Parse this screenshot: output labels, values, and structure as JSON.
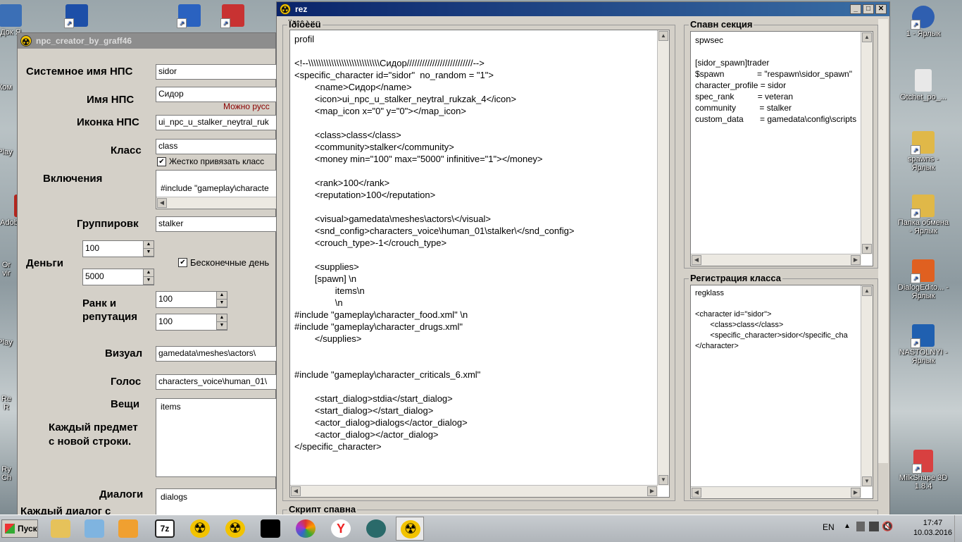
{
  "desktop": {
    "icons_left": [
      {
        "label": "Док\nЯ",
        "color": "#3b6fb6"
      },
      {
        "label": "Ком",
        "color": "#5a7fa8"
      },
      {
        "label": "Play",
        "color": "#2b5da0"
      },
      {
        "label": "Adob",
        "color": "#b3261e"
      },
      {
        "label": "Or\nvir",
        "color": "#3c7bc2"
      },
      {
        "label": "Play",
        "color": "#2b5da0"
      },
      {
        "label": "Re\nR",
        "color": "#c03030"
      },
      {
        "label": "Ry\nCh",
        "color": "#444"
      }
    ],
    "icons_top": [
      {
        "label": "",
        "color": "#1d4fa8"
      },
      {
        "label": "",
        "color": "#2a62c0"
      },
      {
        "label": "",
        "color": "#c83232"
      }
    ],
    "icons_right": [
      {
        "label": "1 - Ярлык",
        "color": "#2f5fb0"
      },
      {
        "label": "Otchet_po_...",
        "color": "#e8e8e8"
      },
      {
        "label": "spawns - Ярлык",
        "color": "#e0b848"
      },
      {
        "label": "Папка обмена - Ярлык",
        "color": "#e0b848"
      },
      {
        "label": "DialogEdito... - Ярлык",
        "color": "#e06020"
      },
      {
        "label": "NASTOLNYI - Ярлык",
        "color": "#2060b0"
      },
      {
        "label": "MilkShape 3D 1.8.4",
        "color": "#d84040"
      }
    ]
  },
  "npc_window": {
    "title": "npc_creator_by_graff46",
    "system_name_label": "Системное имя НПС",
    "system_name_value": "sidor",
    "name_label": "Имя  НПС",
    "name_value": "Сидор",
    "name_hint": "Можно русс",
    "icon_label": "Иконка НПС",
    "icon_value": "ui_npc_u_stalker_neytral_ruk",
    "class_label": "Класс",
    "class_value": "class",
    "class_lock_label": "Жестко привязать класс",
    "includes_label": "Включения",
    "includes_value": "#include \"gameplay\\characte",
    "group_label": "Группировк",
    "group_value": "stalker",
    "money_label": "Деньги",
    "money_min": "100",
    "money_max": "5000",
    "infinite_money_label": "Бесконечные день",
    "rank_label": "Ранк и\nрепутация",
    "rank_value": "100",
    "reputation_value": "100",
    "visual_label": "Визуал",
    "visual_value": "gamedata\\meshes\\actors\\",
    "voice_label": "Голос",
    "voice_value": "characters_voice\\human_01\\",
    "items_label": "Вещи",
    "items_value": "items",
    "items_hint": "Каждый предмет\nс новой строки.",
    "dialogs_label": "Диалоги",
    "dialogs_value": "dialogs",
    "dialogs_hint": "Каждый диалог с"
  },
  "rez_window": {
    "title": "rez",
    "profile_group": "Ïðîôèëü",
    "profile_text": "profil\n\n<!--\\\\\\\\\\\\\\\\\\\\\\\\\\\\\\\\\\\\\\\\\\\\\\\\\\\\\\\\Сидор//////////////////////////-->\n<specific_character id=\"sidor\"  no_random = \"1\">\n        <name>Сидор</name>\n        <icon>ui_npc_u_stalker_neytral_rukzak_4</icon>\n        <map_icon x=\"0\" y=\"0\"></map_icon>\n\n        <class>class</class>\n        <community>stalker</community>\n        <money min=\"100\" max=\"5000\" infinitive=\"1\"></money>\n\n        <rank>100</rank>\n        <reputation>100</reputation>\n\n        <visual>gamedata\\meshes\\actors\\</visual>\n        <snd_config>characters_voice\\human_01\\stalker\\</snd_config>\n        <crouch_type>-1</crouch_type>\n\n        <supplies>\n        [spawn] \\n\n                items\\n\n                \\n\n#include \"gameplay\\character_food.xml\" \\n\n#include \"gameplay\\character_drugs.xml\"\n        </supplies>\n\n\n#include \"gameplay\\character_criticals_6.xml\"\n\n        <start_dialog>stdia</start_dialog>\n        <start_dialog></start_dialog>\n        <actor_dialog>dialogs</actor_dialog>\n        <actor_dialog></actor_dialog>\n</specific_character>",
    "spawn_group": "Спавн секция",
    "spawn_text": "spwsec\n\n[sidor_spawn]trader\n$spawn              = \"respawn\\sidor_spawn\"\ncharacter_profile = sidor\nspec_rank          = veteran\ncommunity          = stalker\ncustom_data       = gamedata\\config\\scripts",
    "class_reg_group": "Регистрация класса",
    "class_reg_text": "regklass\n\n<character id=\"sidor\">\n       <class>class</class>\n       <specific_character>sidor</specific_cha\n</character>",
    "script_group": "Скрипт спавна"
  },
  "taskbar": {
    "start_label": "Пуск",
    "apps": [
      {
        "name": "explorer",
        "color": "#e6c25a"
      },
      {
        "name": "notepad",
        "color": "#7fb4e0"
      },
      {
        "name": "transfer",
        "color": "#f0a030"
      },
      {
        "name": "7zip",
        "color": "#222"
      },
      {
        "name": "radiation1",
        "color": "#f2c300"
      },
      {
        "name": "radiation2",
        "color": "#f2c300"
      },
      {
        "name": "stars",
        "color": "#000"
      },
      {
        "name": "flower",
        "color": "#d33"
      },
      {
        "name": "yandex",
        "color": "#fff"
      },
      {
        "name": "swirl",
        "color": "#2a6a6a"
      },
      {
        "name": "radiation3",
        "color": "#f2c300"
      }
    ],
    "lang": "EN",
    "time": "17:47",
    "date": "10.03.2016"
  }
}
